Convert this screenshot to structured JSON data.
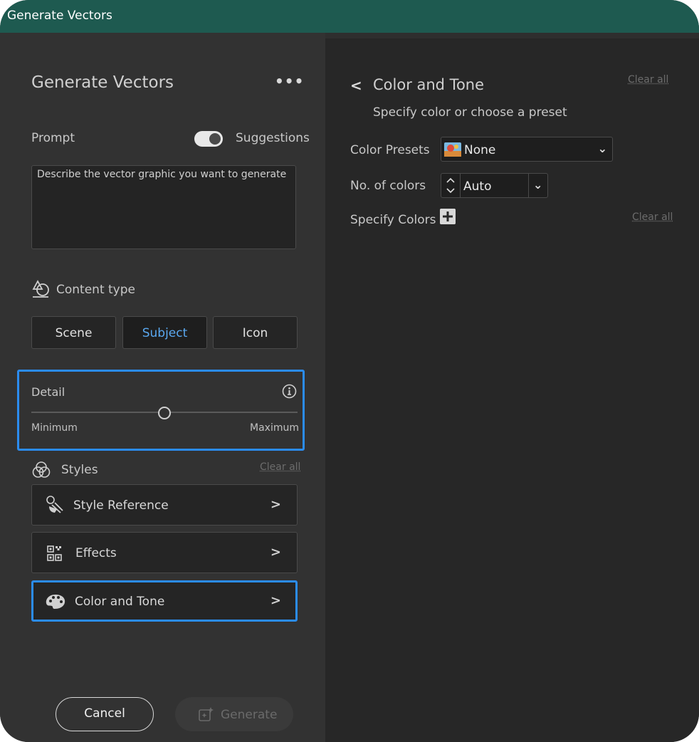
{
  "window": {
    "title": "Generate Vectors"
  },
  "panel": {
    "title": "Generate Vectors",
    "more_label": "•••",
    "prompt_label": "Prompt",
    "suggestions_label": "Suggestions",
    "suggestions_on": true,
    "prompt_placeholder": "Describe the vector graphic you want to generate",
    "content_type_label": "Content type",
    "content_types": [
      {
        "label": "Scene",
        "active": false
      },
      {
        "label": "Subject",
        "active": true
      },
      {
        "label": "Icon",
        "active": false
      }
    ],
    "detail": {
      "label": "Detail",
      "min_label": "Minimum",
      "max_label": "Maximum",
      "value": 0.5
    },
    "styles": {
      "label": "Styles",
      "clear_label": "Clear all"
    },
    "style_rows": [
      {
        "label": "Style Reference",
        "icon": "style-reference-icon"
      },
      {
        "label": "Effects",
        "icon": "effects-icon"
      },
      {
        "label": "Color and Tone",
        "icon": "palette-icon",
        "selected": true
      }
    ],
    "cancel_label": "Cancel",
    "generate_label": "Generate"
  },
  "color_tone": {
    "title": "Color and Tone",
    "subtitle": "Specify color or choose a preset",
    "clear_label": "Clear all",
    "presets_label": "Color Presets",
    "presets_value": "None",
    "num_colors_label": "No. of colors",
    "num_colors_value": "Auto",
    "specify_label": "Specify Colors",
    "specify_clear_label": "Clear all"
  },
  "colors": {
    "accent": "#2b8cf0",
    "titlebar": "#1e5a50",
    "active_text": "#5aa8f0"
  }
}
